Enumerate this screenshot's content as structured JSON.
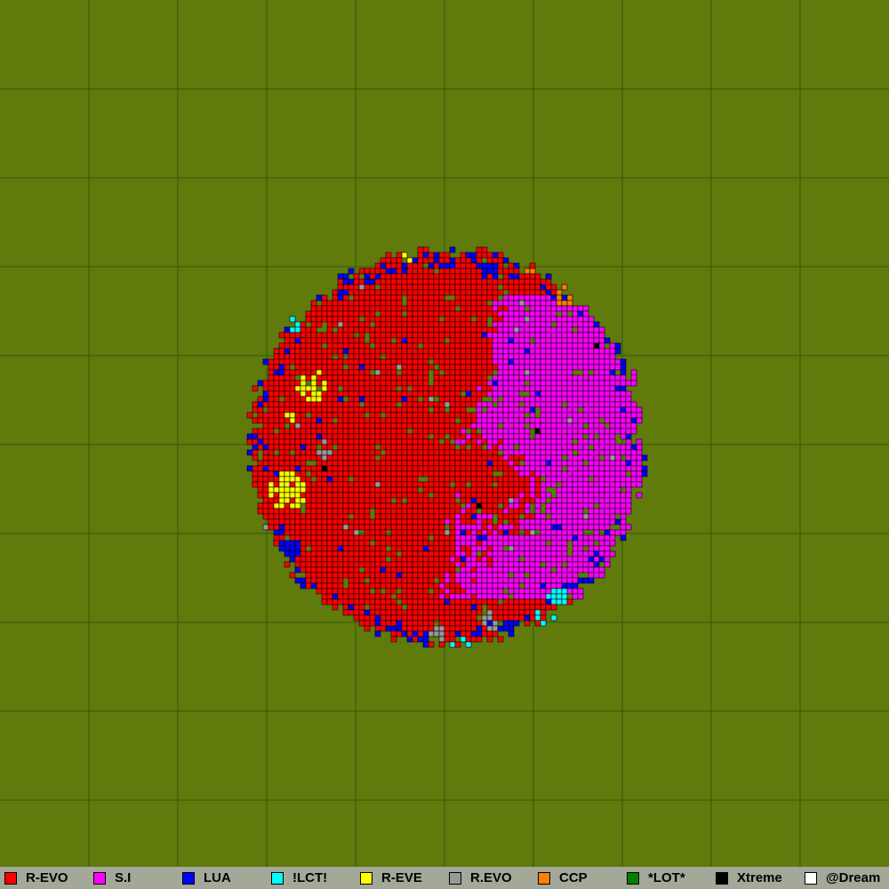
{
  "map": {
    "background_color": "#607a0c",
    "grid_color": "#2f5a0c",
    "grid_divisions": 10,
    "outline_color": "#000000"
  },
  "legend": [
    {
      "label": "R-EVO",
      "color": "#ff0000"
    },
    {
      "label": "S.I",
      "color": "#ff00ff"
    },
    {
      "label": "LUA",
      "color": "#0000ff"
    },
    {
      "label": "!LCT!",
      "color": "#00ffff"
    },
    {
      "label": "R-EVE",
      "color": "#ffff00"
    },
    {
      "label": "R.EVO",
      "color": "#999999"
    },
    {
      "label": "CCP",
      "color": "#ff8000"
    },
    {
      "label": "*LOT*",
      "color": "#008000"
    },
    {
      "label": "Xtreme",
      "color": "#000000"
    },
    {
      "label": "@Dream",
      "color": "#ffffff"
    }
  ]
}
